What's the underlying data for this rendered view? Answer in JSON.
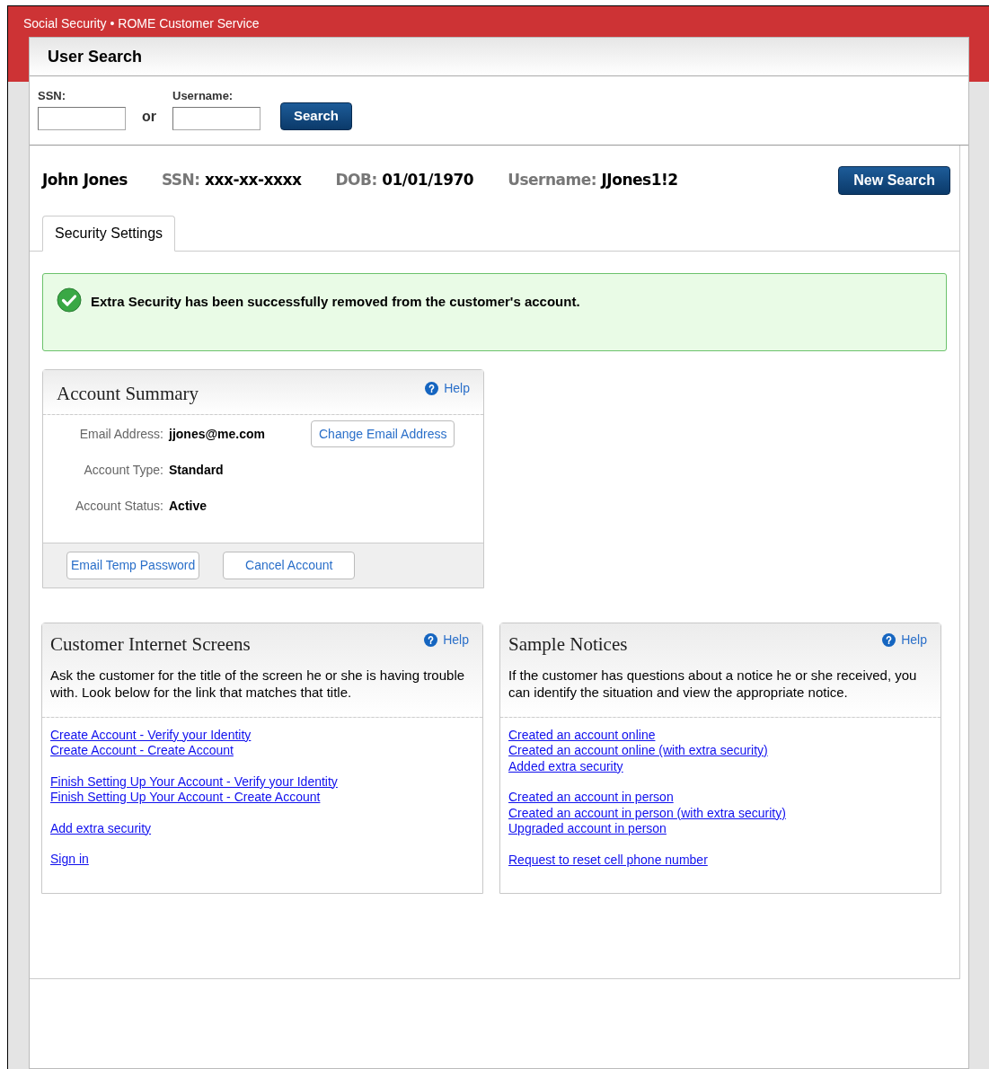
{
  "app_title": "Social Security • ROME Customer Service",
  "panel_title": "User Search",
  "search": {
    "fields": [
      {
        "label": "SSN:"
      },
      {
        "label": "Username:"
      }
    ],
    "separator": "or",
    "button": "Search"
  },
  "customer": {
    "name": "John Jones",
    "facts": [
      {
        "label": "SSN:",
        "value": "xxx-xx-xxxx"
      },
      {
        "label": "DOB:",
        "value": "01/01/1970"
      },
      {
        "label": "Username:",
        "value": "JJones1!2"
      }
    ],
    "button": "New Search"
  },
  "tabs": [
    {
      "label": "Security Settings",
      "selected": true
    }
  ],
  "alert": {
    "kind": "success",
    "message": "Extra Security has been successfully removed from the customer's account."
  },
  "account_summary": {
    "title": "Account Summary",
    "help": "Help",
    "fields": [
      {
        "label": "Email Address:",
        "value": "jjones@me.com",
        "action": "Change Email Address"
      },
      {
        "label": "Account Type:",
        "value": "Standard"
      },
      {
        "label": "Account Status:",
        "value": "Active"
      }
    ],
    "buttons": [
      "Email Temp Password",
      "Cancel Account"
    ]
  },
  "link_panels": [
    {
      "title": "Customer Internet Screens",
      "help": "Help",
      "intro": "Ask the customer for the title of the screen he or she is having trouble with. Look below for the link that matches that title.",
      "groups": [
        [
          "Create Account - Verify your Identity",
          "Create Account - Create Account"
        ],
        [
          "Finish Setting Up Your Account - Verify your Identity",
          "Finish Setting Up Your Account - Create Account"
        ],
        [
          "Add extra security"
        ],
        [
          "Sign in"
        ]
      ]
    },
    {
      "title": "Sample Notices",
      "help": "Help",
      "intro": "If the customer has questions about a notice he or she received, you can identify the situation and view the appropriate notice.",
      "groups": [
        [
          "Created an account online",
          "Created an account online (with extra security)",
          "Added extra security"
        ],
        [
          "Created an account in person",
          "Created an account in person (with extra security)",
          "Upgraded account in person"
        ],
        [
          "Request to reset cell phone number"
        ]
      ]
    }
  ]
}
